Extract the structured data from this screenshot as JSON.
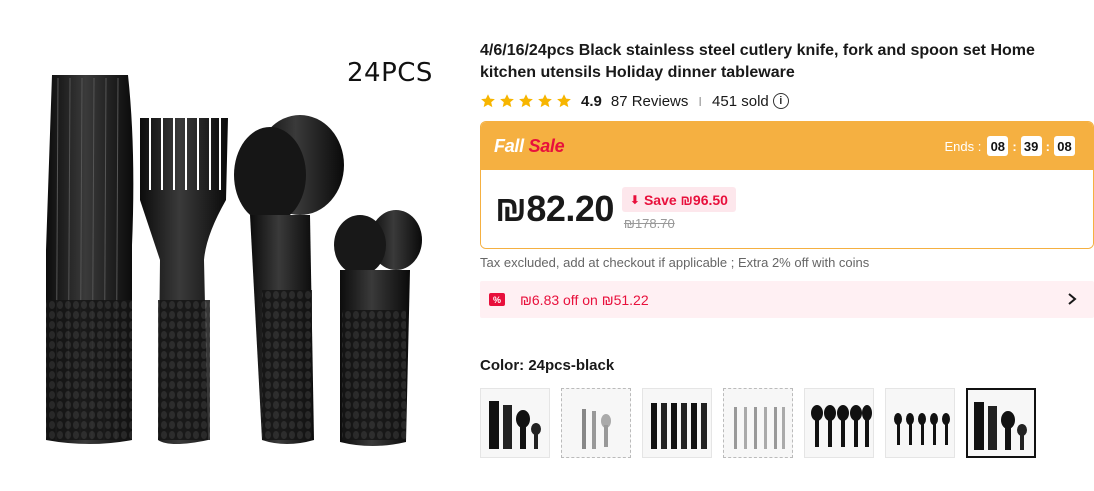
{
  "hero": {
    "label": "24PCS",
    "alt": "Black cutlery set 24 pieces"
  },
  "product": {
    "title": "4/6/16/24pcs Black stainless steel cutlery knife, fork and spoon set Home kitchen utensils Holiday dinner tableware",
    "rating": "4.9",
    "star_count": 5,
    "reviews": "87 Reviews",
    "separator": "I",
    "sold": "451 sold",
    "info_icon": "i"
  },
  "sale": {
    "brand_part1": "Fall",
    "brand_part2": "Sale",
    "ends_label": "Ends :",
    "hours": "08",
    "minutes": "39",
    "seconds": "08",
    "price": "₪82.20",
    "save": "Save ₪96.50",
    "original_price": "₪178.70",
    "colors": {
      "header_bg": "#f5b041",
      "accent": "#e8103c"
    }
  },
  "tax_note": "Tax excluded, add at checkout if applicable ; Extra 2% off with coins",
  "coupon": {
    "icon": "%",
    "text": "₪6.83 off on ₪51.22"
  },
  "color": {
    "label": "Color: 24pcs-black",
    "swatches": [
      {
        "name": "24pcs-black",
        "style": "black"
      },
      {
        "name": "silver-mix",
        "style": "silver-dashed"
      },
      {
        "name": "black-knives",
        "style": "black"
      },
      {
        "name": "silver-forks",
        "style": "silver-dashed"
      },
      {
        "name": "black-spoons",
        "style": "black"
      },
      {
        "name": "black-teaspoons",
        "style": "black"
      },
      {
        "name": "24pcs-black-selected",
        "style": "black-active"
      }
    ]
  }
}
